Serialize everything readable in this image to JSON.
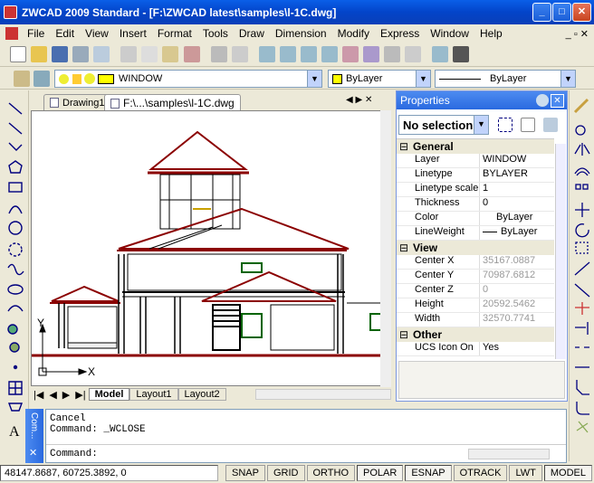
{
  "window": {
    "title": "ZWCAD 2009 Standard - [F:\\ZWCAD latest\\samples\\l-1C.dwg]"
  },
  "menu": [
    "File",
    "Edit",
    "View",
    "Insert",
    "Format",
    "Tools",
    "Draw",
    "Dimension",
    "Modify",
    "Express",
    "Window",
    "Help"
  ],
  "layer": {
    "name": "WINDOW",
    "color": "ByLayer",
    "linetype": "ByLayer"
  },
  "tabs": {
    "doc1": "Drawing1",
    "doc2": "F:\\...\\samples\\l-1C.dwg"
  },
  "layout_tabs": [
    "Model",
    "Layout1",
    "Layout2"
  ],
  "axes": {
    "x": "X",
    "y": "Y"
  },
  "properties": {
    "title": "Properties",
    "selection": "No selection",
    "general": {
      "label": "General",
      "rows": [
        {
          "k": "Layer",
          "v": "WINDOW"
        },
        {
          "k": "Linetype",
          "v": "BYLAYER"
        },
        {
          "k": "Linetype scale",
          "v": "1"
        },
        {
          "k": "Thickness",
          "v": "0"
        },
        {
          "k": "Color",
          "v": "ByLayer"
        },
        {
          "k": "LineWeight",
          "v": "ByLayer"
        }
      ]
    },
    "view": {
      "label": "View",
      "rows": [
        {
          "k": "Center X",
          "v": "35167.0887"
        },
        {
          "k": "Center Y",
          "v": "70987.6812"
        },
        {
          "k": "Center Z",
          "v": "0"
        },
        {
          "k": "Height",
          "v": "20592.5462"
        },
        {
          "k": "Width",
          "v": "32570.7741"
        }
      ]
    },
    "other": {
      "label": "Other",
      "rows": [
        {
          "k": "UCS Icon On",
          "v": "Yes"
        }
      ]
    }
  },
  "command": {
    "side_label": "Com...",
    "lines": [
      "Cancel",
      "Command: _WCLOSE"
    ],
    "prompt": "Command:"
  },
  "status": {
    "coords": "48147.8687, 60725.3892, 0",
    "buttons": [
      "SNAP",
      "GRID",
      "ORTHO",
      "POLAR",
      "ESNAP",
      "OTRACK",
      "LWT",
      "MODEL"
    ]
  }
}
